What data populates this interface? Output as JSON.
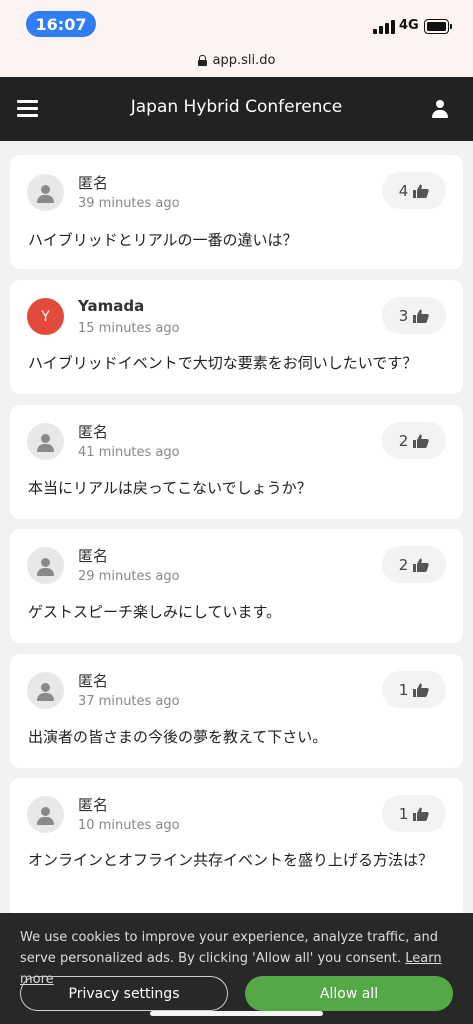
{
  "status_bar": {
    "time": "16:07",
    "network": "4G"
  },
  "browser": {
    "url": "app.sli.do"
  },
  "header": {
    "title": "Japan Hybrid Conference"
  },
  "questions": [
    {
      "author": "匿名",
      "avatar_letter": "",
      "time": "39 minutes ago",
      "likes": "4",
      "text": "ハイブリッドとリアルの一番の違いは？"
    },
    {
      "author": "Yamada",
      "avatar_letter": "Y",
      "time": "15 minutes ago",
      "likes": "3",
      "text": "ハイブリッドイベントで大切な要素をお伺いしたいです？"
    },
    {
      "author": "匿名",
      "avatar_letter": "",
      "time": "41 minutes ago",
      "likes": "2",
      "text": "本当にリアルは戻ってこないでしょうか？"
    },
    {
      "author": "匿名",
      "avatar_letter": "",
      "time": "29 minutes ago",
      "likes": "2",
      "text": "ゲストスピーチ楽しみにしています。"
    },
    {
      "author": "匿名",
      "avatar_letter": "",
      "time": "37 minutes ago",
      "likes": "1",
      "text": "出演者の皆さまの今後の夢を教えて下さい。"
    },
    {
      "author": "匿名",
      "avatar_letter": "",
      "time": "10 minutes ago",
      "likes": "1",
      "text": "オンラインとオフライン共存イベントを盛り上げる方法は？"
    }
  ],
  "cookie_banner": {
    "text": "We use cookies to improve your experience, analyze traffic, and serve personalized ads. By clicking 'Allow all' you consent.",
    "learn_more": "Learn more",
    "privacy_label": "Privacy settings",
    "allow_label": "Allow all"
  },
  "colors": {
    "accent_blue": "#2f7ef5",
    "header_bg": "#222222",
    "allow_green": "#54a846",
    "avatar_red": "#e24b3b"
  }
}
